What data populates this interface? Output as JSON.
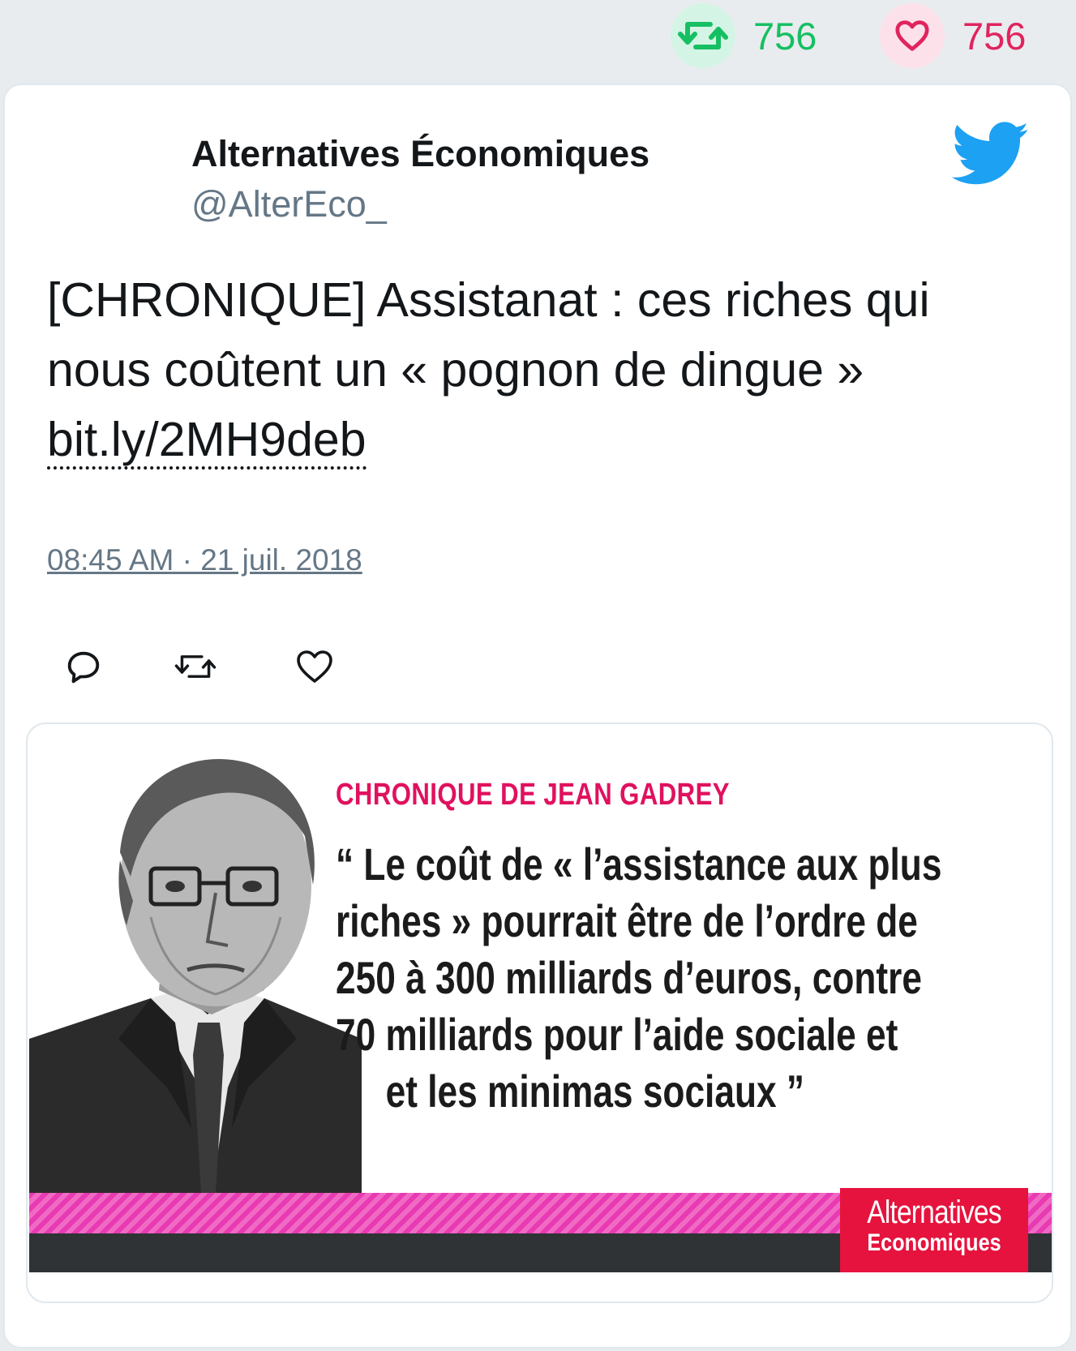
{
  "stats": {
    "retweets": "756",
    "likes": "756",
    "retweet_color": "#17bf63",
    "like_color": "#e0245e"
  },
  "tweet": {
    "author_name": "Alternatives Économiques",
    "author_handle": "@AlterEco_",
    "text": "[CHRONIQUE] Assistanat : ces riches qui nous coûtent un « pognon de dingue » ",
    "link": "bit.ly/2MH9deb",
    "timestamp": "08:45 AM · 21 juil. 2018",
    "brand_icon": "twitter-bird-icon",
    "brand_color": "#1da1f2"
  },
  "actions": [
    {
      "name": "reply-icon"
    },
    {
      "name": "retweet-icon"
    },
    {
      "name": "like-icon"
    }
  ],
  "media": {
    "column_label": "CHRONIQUE DE JEAN GADREY",
    "quote_lines": [
      "“ Le coût de « l’assistance aux plus",
      "riches » pourrait être de l’ordre de",
      "250 à 300 milliards d’euros, contre",
      "70 milliards pour l’aide sociale et",
      "et les minimas sociaux ”"
    ],
    "logo_line1": "Alternatives",
    "logo_line2": "Economiques",
    "accent_color": "#e0115f",
    "band_color": "#e83ab3"
  }
}
